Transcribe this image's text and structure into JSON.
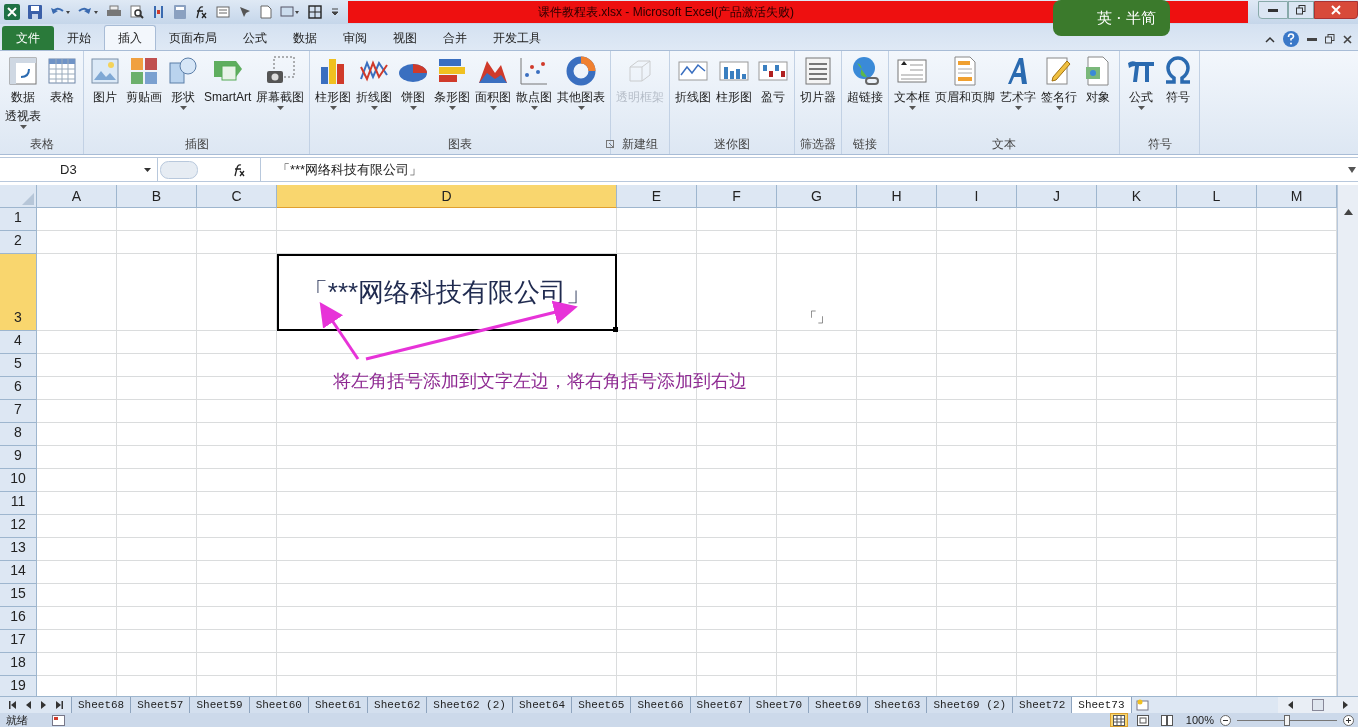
{
  "title_bar": {
    "title": "课件教程表.xlsx - Microsoft Excel(产品激活失败)",
    "ime_badge": "英 · 半简"
  },
  "ribbon_tabs": [
    {
      "label": "文件",
      "selected": false,
      "kind": "file"
    },
    {
      "label": "开始",
      "selected": false,
      "kind": "tab"
    },
    {
      "label": "插入",
      "selected": true,
      "kind": "tab"
    },
    {
      "label": "页面布局",
      "selected": false,
      "kind": "tab"
    },
    {
      "label": "公式",
      "selected": false,
      "kind": "tab"
    },
    {
      "label": "数据",
      "selected": false,
      "kind": "tab"
    },
    {
      "label": "审阅",
      "selected": false,
      "kind": "tab"
    },
    {
      "label": "视图",
      "selected": false,
      "kind": "tab"
    },
    {
      "label": "合并",
      "selected": false,
      "kind": "tab"
    },
    {
      "label": "开发工具",
      "selected": false,
      "kind": "tab"
    }
  ],
  "ribbon_groups": [
    {
      "label": "表格",
      "launcher": false,
      "buttons": [
        {
          "kind": "pivot",
          "lines": [
            "数据",
            "透视表"
          ],
          "dropdown": true,
          "disabled": false
        },
        {
          "kind": "table",
          "lines": [
            "表格"
          ],
          "dropdown": false,
          "disabled": false
        }
      ]
    },
    {
      "label": "插图",
      "launcher": false,
      "buttons": [
        {
          "kind": "picture",
          "lines": [
            "图片"
          ],
          "dropdown": false,
          "disabled": false
        },
        {
          "kind": "clipart",
          "lines": [
            "剪贴画"
          ],
          "dropdown": false,
          "disabled": false
        },
        {
          "kind": "shapes",
          "lines": [
            "形状"
          ],
          "dropdown": true,
          "disabled": false
        },
        {
          "kind": "smartart",
          "lines": [
            "SmartArt"
          ],
          "dropdown": false,
          "disabled": false
        },
        {
          "kind": "screenshot",
          "lines": [
            "屏幕截图"
          ],
          "dropdown": true,
          "disabled": false
        }
      ]
    },
    {
      "label": "图表",
      "launcher": true,
      "buttons": [
        {
          "kind": "column",
          "lines": [
            "柱形图"
          ],
          "dropdown": true,
          "disabled": false
        },
        {
          "kind": "line",
          "lines": [
            "折线图"
          ],
          "dropdown": true,
          "disabled": false
        },
        {
          "kind": "pie",
          "lines": [
            "饼图"
          ],
          "dropdown": true,
          "disabled": false
        },
        {
          "kind": "bar",
          "lines": [
            "条形图"
          ],
          "dropdown": true,
          "disabled": false
        },
        {
          "kind": "area",
          "lines": [
            "面积图"
          ],
          "dropdown": true,
          "disabled": false
        },
        {
          "kind": "scatter",
          "lines": [
            "散点图"
          ],
          "dropdown": true,
          "disabled": false
        },
        {
          "kind": "donut",
          "lines": [
            "其他图表"
          ],
          "dropdown": true,
          "disabled": false
        }
      ]
    },
    {
      "label": "新建组",
      "launcher": false,
      "buttons": [
        {
          "kind": "cube",
          "lines": [
            "透明框架"
          ],
          "dropdown": false,
          "disabled": true
        }
      ]
    },
    {
      "label": "迷你图",
      "launcher": false,
      "buttons": [
        {
          "kind": "sparkline",
          "lines": [
            "折线图"
          ],
          "dropdown": false,
          "disabled": false
        },
        {
          "kind": "minibars",
          "lines": [
            "柱形图"
          ],
          "dropdown": false,
          "disabled": false
        },
        {
          "kind": "winloss",
          "lines": [
            "盈亏"
          ],
          "dropdown": false,
          "disabled": false
        }
      ]
    },
    {
      "label": "筛选器",
      "launcher": false,
      "buttons": [
        {
          "kind": "slicer",
          "lines": [
            "切片器"
          ],
          "dropdown": false,
          "disabled": false
        }
      ]
    },
    {
      "label": "链接",
      "launcher": false,
      "buttons": [
        {
          "kind": "globe",
          "lines": [
            "超链接"
          ],
          "dropdown": false,
          "disabled": false
        }
      ]
    },
    {
      "label": "文本",
      "launcher": false,
      "buttons": [
        {
          "kind": "textbox",
          "lines": [
            "文本框"
          ],
          "dropdown": true,
          "disabled": false
        },
        {
          "kind": "header",
          "lines": [
            "页眉和页脚"
          ],
          "dropdown": false,
          "disabled": false
        },
        {
          "kind": "wordart",
          "lines": [
            "艺术字"
          ],
          "dropdown": true,
          "disabled": false
        },
        {
          "kind": "signature",
          "lines": [
            "签名行"
          ],
          "dropdown": true,
          "disabled": false
        },
        {
          "kind": "object",
          "lines": [
            "对象"
          ],
          "dropdown": false,
          "disabled": false
        }
      ]
    },
    {
      "label": "符号",
      "launcher": false,
      "buttons": [
        {
          "kind": "equation",
          "lines": [
            "公式"
          ],
          "dropdown": true,
          "disabled": false
        },
        {
          "kind": "symbol",
          "lines": [
            "符号"
          ],
          "dropdown": false,
          "disabled": false
        }
      ]
    }
  ],
  "formula_bar": {
    "name_box": "D3",
    "value": "「***网络科技有限公司」"
  },
  "columns": [
    {
      "label": "A",
      "selected": false
    },
    {
      "label": "B",
      "selected": false
    },
    {
      "label": "C",
      "selected": false
    },
    {
      "label": "D",
      "selected": true
    },
    {
      "label": "E",
      "selected": false
    },
    {
      "label": "F",
      "selected": false
    },
    {
      "label": "G",
      "selected": false
    },
    {
      "label": "H",
      "selected": false
    },
    {
      "label": "I",
      "selected": false
    },
    {
      "label": "J",
      "selected": false
    },
    {
      "label": "K",
      "selected": false
    },
    {
      "label": "L",
      "selected": false
    },
    {
      "label": "M",
      "selected": false
    }
  ],
  "rows": [
    {
      "label": "1",
      "selected": false
    },
    {
      "label": "2",
      "selected": false
    },
    {
      "label": "3",
      "selected": true,
      "cells": [
        {
          "kind": "empty"
        },
        {
          "kind": "empty"
        },
        {
          "kind": "empty"
        },
        {
          "kind": "text",
          "text": "「***网络科技有限公司」",
          "active": true
        },
        {
          "kind": "empty"
        },
        {
          "kind": "empty"
        },
        {
          "kind": "text",
          "text": "「」",
          "active": false
        },
        {
          "kind": "empty"
        },
        {
          "kind": "empty"
        },
        {
          "kind": "empty"
        },
        {
          "kind": "empty"
        },
        {
          "kind": "empty"
        },
        {
          "kind": "empty"
        }
      ]
    },
    {
      "label": "4",
      "selected": false
    },
    {
      "label": "5",
      "selected": false
    },
    {
      "label": "6",
      "selected": false
    },
    {
      "label": "7",
      "selected": false
    },
    {
      "label": "8",
      "selected": false
    },
    {
      "label": "9",
      "selected": false
    },
    {
      "label": "10",
      "selected": false
    },
    {
      "label": "11",
      "selected": false
    },
    {
      "label": "12",
      "selected": false
    },
    {
      "label": "13",
      "selected": false
    },
    {
      "label": "14",
      "selected": false
    },
    {
      "label": "15",
      "selected": false
    },
    {
      "label": "16",
      "selected": false
    },
    {
      "label": "17",
      "selected": false
    },
    {
      "label": "18",
      "selected": false
    },
    {
      "label": "19",
      "selected": false
    }
  ],
  "annotation": {
    "text": "将左角括号添加到文字左边，将右角括号添加到右边"
  },
  "sheet_tabs": [
    {
      "label": "Sheet68",
      "selected": false
    },
    {
      "label": "Sheet57",
      "selected": false
    },
    {
      "label": "Sheet59",
      "selected": false
    },
    {
      "label": "Sheet60",
      "selected": false
    },
    {
      "label": "Sheet61",
      "selected": false
    },
    {
      "label": "Sheet62",
      "selected": false
    },
    {
      "label": "Sheet62 (2)",
      "selected": false
    },
    {
      "label": "Sheet64",
      "selected": false
    },
    {
      "label": "Sheet65",
      "selected": false
    },
    {
      "label": "Sheet66",
      "selected": false
    },
    {
      "label": "Sheet67",
      "selected": false
    },
    {
      "label": "Sheet70",
      "selected": false
    },
    {
      "label": "Sheet69",
      "selected": false
    },
    {
      "label": "Sheet63",
      "selected": false
    },
    {
      "label": "Sheet69 (2)",
      "selected": false
    },
    {
      "label": "Sheet72",
      "selected": false
    },
    {
      "label": "Sheet73",
      "selected": true
    }
  ],
  "status_bar": {
    "status": "就绪",
    "views": [
      {
        "kind": "normal",
        "selected": true
      },
      {
        "kind": "layout",
        "selected": false
      },
      {
        "kind": "pagebreak",
        "selected": false
      }
    ],
    "zoom": "100%",
    "zoom_slider": {
      "level": 0.5
    }
  }
}
